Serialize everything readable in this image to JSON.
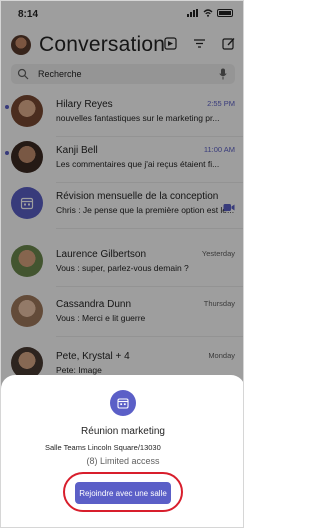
{
  "status_bar": {
    "time": "8:14"
  },
  "header": {
    "title": "Conversation"
  },
  "search": {
    "placeholder": "Recherche"
  },
  "chats": [
    {
      "name": "Hilary Reyes",
      "preview": "nouvelles fantastiques sur le marketing pr...",
      "date": "2:55 PM",
      "unread": true
    },
    {
      "name": "Kanji Bell",
      "preview": "Les commentaires que j'ai reçus étaient fi...",
      "date": "11:00 AM",
      "unread": true
    },
    {
      "name": "Révision mensuelle de la conception",
      "preview": "Chris : Je pense que la première option est le...",
      "date": "",
      "unread": false
    },
    {
      "name": "Laurence Gilbertson",
      "preview": "Vous : super, parlez-vous demain ?",
      "date": "Yesterday",
      "unread": false
    },
    {
      "name": "Cassandra Dunn",
      "preview": "Vous : Merci e lit guerre",
      "date": "Thursday",
      "unread": false
    },
    {
      "name": "Pete, Krystal + 4",
      "preview": "Pete: Image",
      "date": "Monday",
      "unread": false
    }
  ],
  "sheet": {
    "meeting_title": "Réunion marketing",
    "room": "Salle Teams Lincoln Square/13030",
    "access": "(8) Limited access",
    "join_label": "Rejoindre avec une salle"
  },
  "colors": {
    "accent": "#5b5fc7",
    "highlight_ring": "#d81e2c"
  },
  "icons": [
    "signal-icon",
    "wifi-icon",
    "battery-icon",
    "video-icon",
    "filter-icon",
    "compose-icon",
    "search-icon",
    "microphone-icon",
    "calendar-icon",
    "meeting-icon"
  ]
}
